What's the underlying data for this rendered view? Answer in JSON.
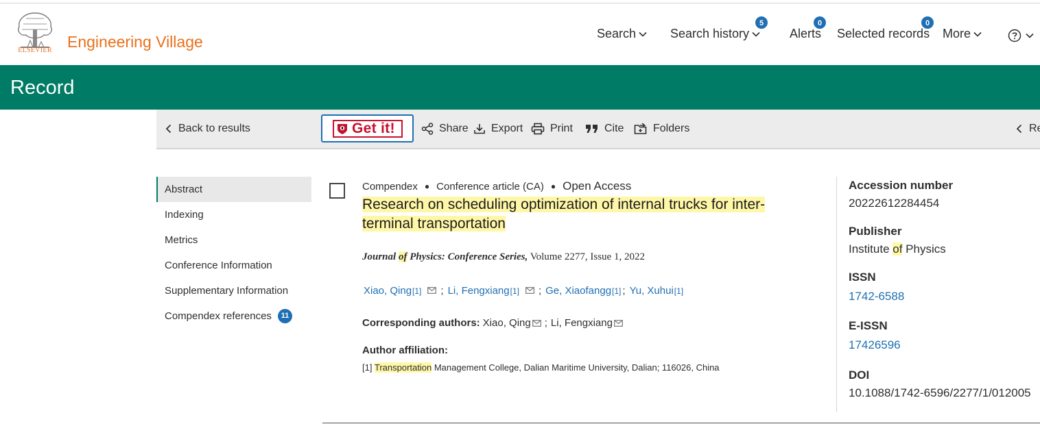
{
  "brand": {
    "logo_word": "ELSEVIER",
    "name": "Engineering Village",
    "color": "#e9711c"
  },
  "nav": {
    "search": "Search",
    "search_history": "Search history",
    "search_history_count": "5",
    "alerts": "Alerts",
    "alerts_count": "0",
    "selected_records": "Selected records",
    "selected_records_count": "0",
    "more": "More",
    "help_icon": "help-circle-icon"
  },
  "banner": {
    "title": "Record",
    "color": "#007b65"
  },
  "toolbar": {
    "back": "Back to results",
    "getit": "Get it!",
    "share": "Share",
    "export": "Export",
    "print": "Print",
    "cite": "Cite",
    "folders": "Folders",
    "prev_partial": "Re"
  },
  "sidebar": {
    "items": [
      {
        "label": "Abstract"
      },
      {
        "label": "Indexing"
      },
      {
        "label": "Metrics"
      },
      {
        "label": "Conference Information"
      },
      {
        "label": "Supplementary Information"
      },
      {
        "label": "Compendex references",
        "count": "11"
      }
    ]
  },
  "record": {
    "database": "Compendex",
    "doc_type": "Conference article (CA)",
    "access": "Open Access",
    "title": "Research on scheduling optimization of internal trucks for inter-terminal transportation",
    "journal": {
      "name_pre": "Journal ",
      "name_hl": "of",
      "name_post": " Physics: Conference Series,",
      "rest": " Volume 2277, Issue 1, 2022"
    },
    "authors": [
      {
        "name": "Xiao, Qing",
        "ref": "[1]"
      },
      {
        "name": "Li, Fengxiang",
        "ref": "[1]"
      },
      {
        "name": "Ge, Xiaofangg",
        "ref": "[1]"
      },
      {
        "name": "Yu, Xuhui",
        "ref": "[1]"
      }
    ],
    "corresponding_label": "Corresponding authors:",
    "corresponding": [
      "Xiao, Qing",
      "Li, Fengxiang"
    ],
    "affiliation_label": "Author affiliation:",
    "affiliation": {
      "ref": "[1]",
      "hl": "Transportation",
      "rest": " Management College, Dalian Maritime University, Dalian; 116026, China"
    }
  },
  "details": {
    "accession_label": "Accession number",
    "accession": "20222612284454",
    "publisher_label": "Publisher",
    "publisher_pre": "Institute ",
    "publisher_hl": "of",
    "publisher_post": " Physics",
    "issn_label": "ISSN",
    "issn": "1742-6588",
    "eissn_label": "E-ISSN",
    "eissn": "17426596",
    "doi_label": "DOI",
    "doi": "10.1088/1742-6596/2277/1/012005"
  },
  "colors": {
    "link": "#1f6fb2",
    "highlight": "#fff7a8",
    "getit_red": "#c8102e"
  }
}
